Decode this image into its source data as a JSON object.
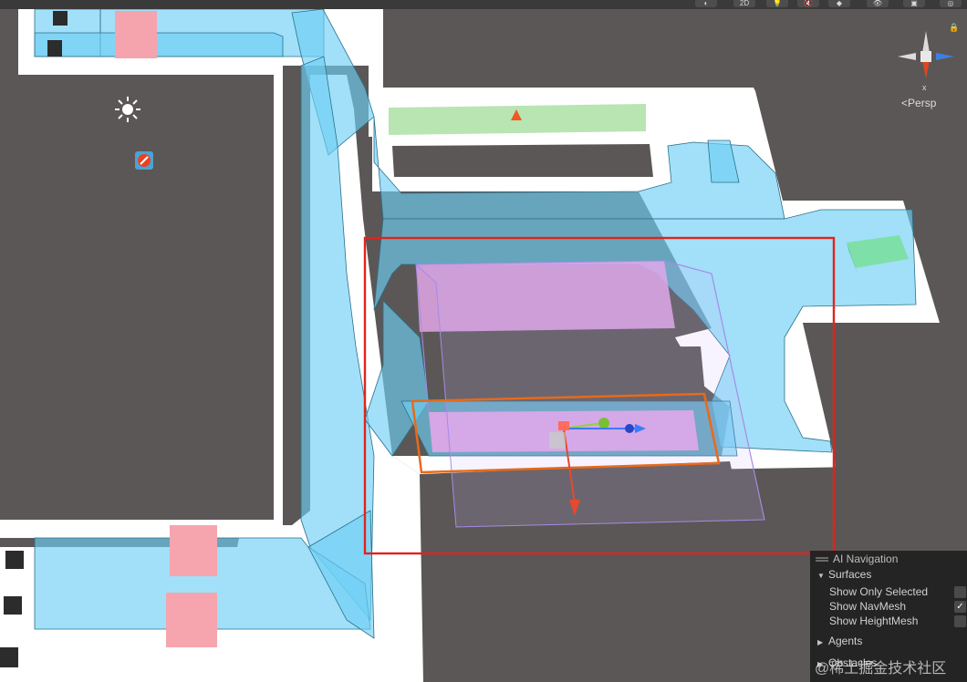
{
  "toolbar": {
    "buttons": [
      {
        "name": "shading-mode-button",
        "label": "◐"
      },
      {
        "name": "2d-toggle-button",
        "label": "2D"
      },
      {
        "name": "lighting-toggle-button",
        "label": "💡"
      },
      {
        "name": "audio-toggle-button",
        "label": "🔇"
      },
      {
        "name": "effects-toggle-button",
        "label": "◆"
      },
      {
        "name": "hidden-objects-button",
        "label": "👁"
      },
      {
        "name": "camera-settings-button",
        "label": "▣"
      },
      {
        "name": "gizmos-button",
        "label": "◎"
      }
    ]
  },
  "scene": {
    "projection_label": "Persp",
    "gizmo_axis_label": "x"
  },
  "ai_navigation": {
    "title": "AI Navigation",
    "surfaces": {
      "label": "Surfaces",
      "options": [
        {
          "label": "Show Only Selected",
          "checked": false
        },
        {
          "label": "Show NavMesh",
          "checked": true
        },
        {
          "label": "Show HeightMesh",
          "checked": false
        }
      ]
    },
    "agents_label": "Agents",
    "obstacles_label": "Obstacles"
  },
  "watermark": "@稀土掘金技术社区",
  "colors": {
    "ground": "#5b5756",
    "floor_white": "#ffffff",
    "navmesh_blue": "#7fd8f5",
    "selected_box_purple": "#e3a6e8",
    "selection_red": "#e0241c",
    "selection_orange": "#e86a1a",
    "green_strip": "#b7e4b0"
  }
}
